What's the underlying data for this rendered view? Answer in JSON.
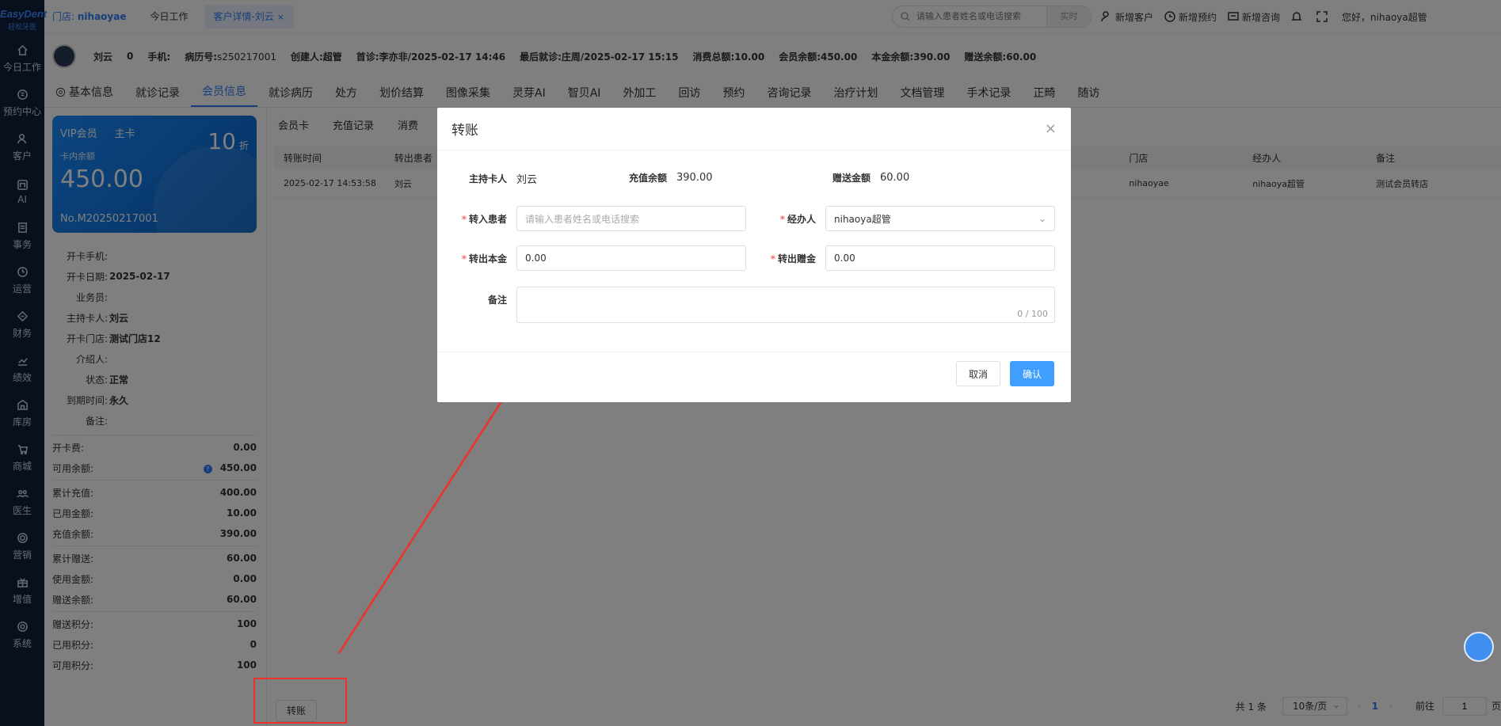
{
  "sidebar": {
    "logo_main": "EasyDent",
    "logo_sub": "轻松牙医",
    "items": [
      {
        "label": "今日工作",
        "icon": "home-icon"
      },
      {
        "label": "预约中心",
        "icon": "calendar-icon"
      },
      {
        "label": "客户",
        "icon": "user-icon"
      },
      {
        "label": "AI",
        "icon": "ai-icon"
      },
      {
        "label": "事务",
        "icon": "doc-icon"
      },
      {
        "label": "运营",
        "icon": "clock-icon"
      },
      {
        "label": "财务",
        "icon": "money-icon"
      },
      {
        "label": "绩效",
        "icon": "chart-icon"
      },
      {
        "label": "库房",
        "icon": "warehouse-icon"
      },
      {
        "label": "商城",
        "icon": "cart-icon"
      },
      {
        "label": "医生",
        "icon": "doctor-icon"
      },
      {
        "label": "营销",
        "icon": "target-icon"
      },
      {
        "label": "增值",
        "icon": "gift-icon"
      },
      {
        "label": "系统",
        "icon": "gear-icon"
      }
    ]
  },
  "topbar": {
    "store_label": "门店:",
    "store_name": "nihaoyae",
    "tabs": [
      {
        "label": "今日工作"
      },
      {
        "label": "客户详情-刘云",
        "close": "×"
      }
    ],
    "search_placeholder": "请输入患者姓名或电话搜索",
    "search_mode": "实时",
    "actions": [
      "新增客户",
      "新增预约",
      "新增咨询"
    ],
    "greeting": "您好，nihaoya超管"
  },
  "patient": {
    "name": "刘云",
    "age": "0",
    "phone_label": "手机:",
    "record_label": "病历号:",
    "record_no": "s250217001",
    "creator": "创建人:超管",
    "first_visit": "首诊:李亦非/2025-02-17 14:46",
    "last_visit": "最后就诊:庄周/2025-02-17 15:15",
    "total_spent": "消费总额:10.00",
    "member_balance": "会员余额:450.00",
    "principal_balance": "本金余额:390.00",
    "gift_balance": "赠送余额:60.00"
  },
  "main_tabs": [
    "基本信息",
    "就诊记录",
    "会员信息",
    "就诊病历",
    "处方",
    "划价结算",
    "图像采集",
    "灵芽AI",
    "智贝AI",
    "外加工",
    "回访",
    "预约",
    "咨询记录",
    "治疗计划",
    "文档管理",
    "手术记录",
    "正畸",
    "随访"
  ],
  "main_tab_active": "会员信息",
  "card": {
    "level": "VIP会员",
    "type": "主卡",
    "discount": "10",
    "discount_unit": "折",
    "balance_label": "卡内余额",
    "balance": "450.00",
    "card_no": "No.M20250217001"
  },
  "card_info": [
    {
      "k": "开卡手机:",
      "v": ""
    },
    {
      "k": "开卡日期:",
      "v": "2025-02-17"
    },
    {
      "k": "业务员:",
      "v": ""
    },
    {
      "k": "主持卡人:",
      "v": "刘云"
    },
    {
      "k": "开卡门店:",
      "v": "测试门店12"
    },
    {
      "k": "介绍人:",
      "v": ""
    },
    {
      "k": "状态:",
      "v": "正常"
    },
    {
      "k": "到期时间:",
      "v": "永久"
    },
    {
      "k": "备注:",
      "v": ""
    }
  ],
  "stats": [
    {
      "k": "开卡费:",
      "v": "0.00"
    },
    {
      "k": "可用余额:",
      "v": "450.00"
    },
    {
      "k": "累计充值:",
      "v": "400.00"
    },
    {
      "k": "已用金额:",
      "v": "10.00"
    },
    {
      "k": "充值余额:",
      "v": "390.00"
    },
    {
      "k": "累计赠送:",
      "v": "60.00"
    },
    {
      "k": "使用金额:",
      "v": "0.00"
    },
    {
      "k": "赠送余额:",
      "v": "60.00"
    },
    {
      "k": "赠送积分:",
      "v": "100"
    },
    {
      "k": "已用积分:",
      "v": "0"
    },
    {
      "k": "可用积分:",
      "v": "100"
    }
  ],
  "sub_tabs": [
    "会员卡",
    "充值记录",
    "消费"
  ],
  "table": {
    "headers": [
      "转账时间",
      "转出患者",
      "门店",
      "经办人",
      "备注"
    ],
    "rows": [
      [
        "2025-02-17 14:53:58",
        "刘云",
        "nihaoyae",
        "nihaoya超管",
        "测试会员转店"
      ]
    ]
  },
  "pagination": {
    "total": "共 1 条",
    "page_size": "10条/页",
    "prev": "‹",
    "current": "1",
    "next": "›",
    "goto_label": "前往",
    "goto_value": "1",
    "page_unit": "页"
  },
  "transfer_button": "转账",
  "modal": {
    "title": "转账",
    "close": "×",
    "holder_label": "主持卡人",
    "holder_value": "刘云",
    "recharge_label": "充值余额",
    "recharge_value": "390.00",
    "gift_label": "赠送金额",
    "gift_value": "60.00",
    "to_patient_label": "转入患者",
    "to_patient_placeholder": "请输入患者姓名或电话搜索",
    "handler_label": "经办人",
    "handler_value": "nihaoya超管",
    "principal_label": "转出本金",
    "principal_value": "0.00",
    "gift_out_label": "转出赠金",
    "gift_out_value": "0.00",
    "remark_label": "备注",
    "remark_count": "0 / 100",
    "required_mark": "*",
    "cancel": "取消",
    "confirm": "确认"
  },
  "colors": {
    "accent": "#2f7df6",
    "sidebar_bg": "#13203a",
    "annotation": "#f0302b",
    "confirm": "#409eff"
  }
}
